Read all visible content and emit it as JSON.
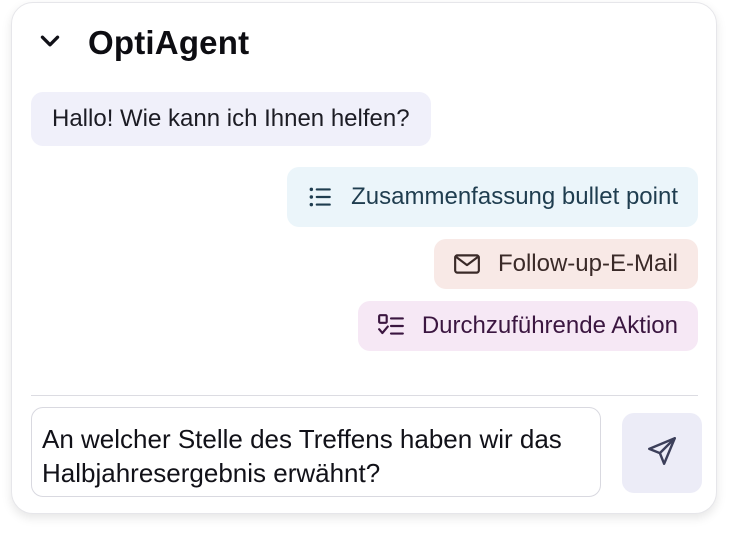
{
  "panel": {
    "title": "OptiAgent",
    "collapse_icon": "chevron-down-icon"
  },
  "messages": [
    {
      "role": "assistant",
      "text": "Hallo! Wie kann ich Ihnen helfen?"
    }
  ],
  "suggestions": [
    {
      "label": "Zusammenfassung bullet point",
      "icon": "bullet-list-icon",
      "color": "#ebf5fa"
    },
    {
      "label": "Follow-up-E-Mail",
      "icon": "mail-icon",
      "color": "#f8e9e6"
    },
    {
      "label": "Durchzuführende Aktion",
      "icon": "checklist-icon",
      "color": "#f6e8f5"
    }
  ],
  "composer": {
    "value": "An welcher Stelle des Treffens haben wir das Halbjahresergebnis erwähnt?",
    "send_icon": "send-icon"
  }
}
